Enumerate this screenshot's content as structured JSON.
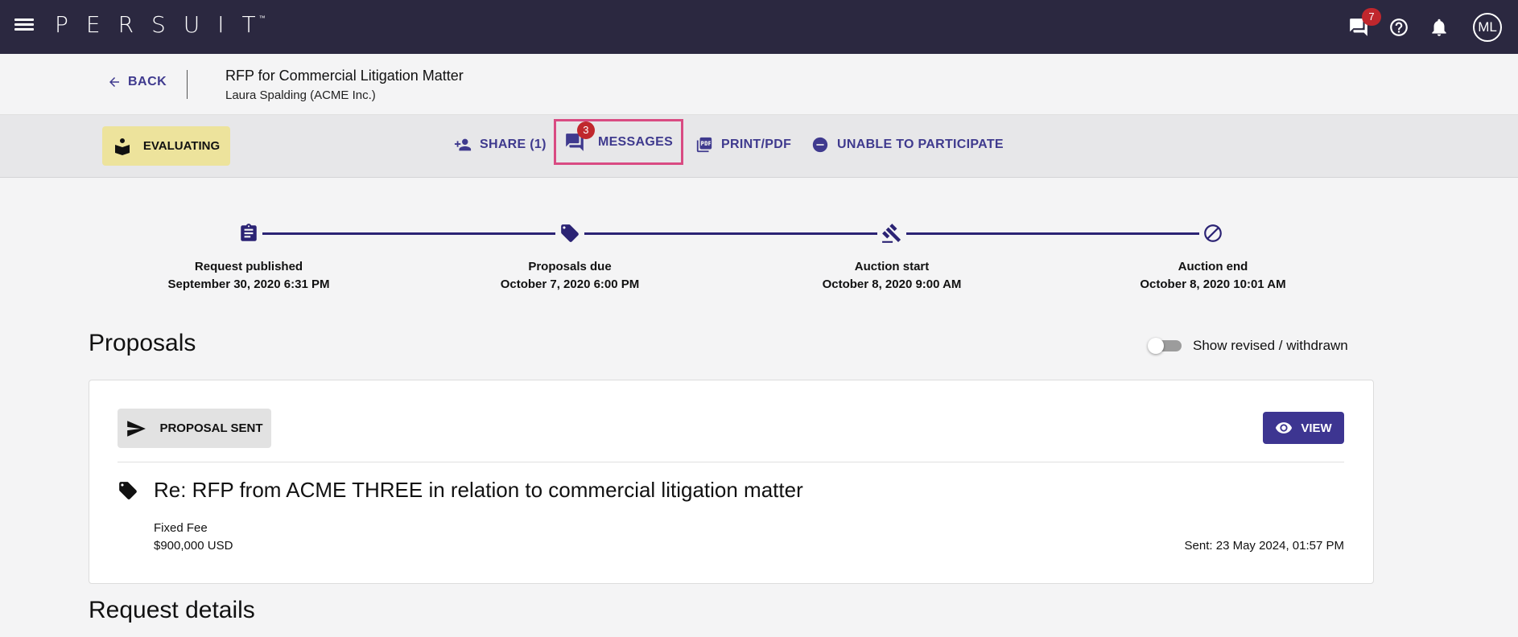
{
  "topbar": {
    "logo": "PERSUIT",
    "logo_tm": "™",
    "messages_badge": "7",
    "avatar_initials": "ML"
  },
  "header": {
    "back_label": "BACK",
    "title": "RFP for Commercial Litigation Matter",
    "subtitle": "Laura Spalding (ACME Inc.)"
  },
  "actions": {
    "status": "EVALUATING",
    "share": "SHARE (1)",
    "messages": "MESSAGES",
    "messages_badge": "3",
    "print": "PRINT/PDF",
    "unable": "UNABLE TO PARTICIPATE"
  },
  "timeline": [
    {
      "label": "Request published",
      "date": "September 30, 2020 6:31 PM",
      "icon": "clipboard-icon"
    },
    {
      "label": "Proposals due",
      "date": "October 7, 2020 6:00 PM",
      "icon": "tag-icon"
    },
    {
      "label": "Auction start",
      "date": "October 8, 2020 9:00 AM",
      "icon": "gavel-icon"
    },
    {
      "label": "Auction end",
      "date": "October 8, 2020 10:01 AM",
      "icon": "block-icon"
    }
  ],
  "proposals": {
    "title": "Proposals",
    "toggle_label": "Show revised / withdrawn",
    "toggle_on": false,
    "card": {
      "status": "PROPOSAL SENT",
      "view_label": "VIEW",
      "title": "Re: RFP from ACME THREE in relation to commercial litigation matter",
      "fee_type": "Fixed Fee",
      "fee_amount": "$900,000 USD",
      "sent": "Sent: 23 May 2024, 01:57 PM"
    }
  },
  "request_details": {
    "title": "Request details"
  },
  "colors": {
    "topbar": "#2b2840",
    "accent": "#3f3a8e",
    "status_chip": "#ede39c",
    "badge": "#c0272d",
    "highlight": "#d94b82"
  }
}
